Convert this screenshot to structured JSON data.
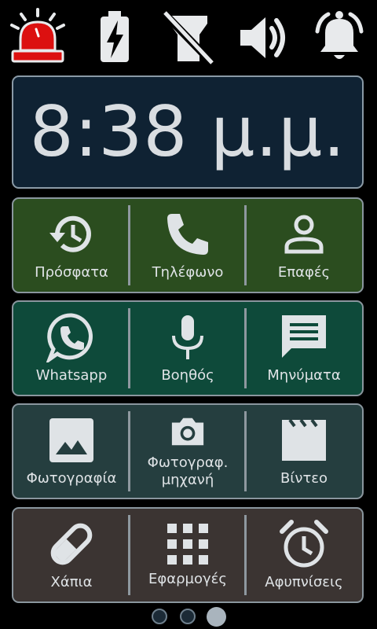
{
  "clock": {
    "time": "8:38 μ.μ."
  },
  "status_icons": [
    "alarm-siren-icon",
    "battery-charging-icon",
    "flashlight-off-icon",
    "volume-icon",
    "bell-icon"
  ],
  "rows": [
    {
      "color": "#2b4d1f",
      "items": [
        {
          "label": "Πρόσφατα",
          "icon": "history-icon"
        },
        {
          "label": "Τηλέφωνο",
          "icon": "phone-icon"
        },
        {
          "label": "Επαφές",
          "icon": "contact-icon"
        }
      ]
    },
    {
      "color": "#0e4a3a",
      "items": [
        {
          "label": "Whatsapp",
          "icon": "whatsapp-icon"
        },
        {
          "label": "Βοηθός",
          "icon": "microphone-icon"
        },
        {
          "label": "Μηνύματα",
          "icon": "message-icon"
        }
      ]
    },
    {
      "color": "#253e3f",
      "items": [
        {
          "label": "Φωτογραφία",
          "icon": "image-icon"
        },
        {
          "label": "Φωτογραφ.\nμηχανή",
          "icon": "camera-icon"
        },
        {
          "label": "Βίντεο",
          "icon": "clapperboard-icon"
        }
      ]
    },
    {
      "color": "#3b3432",
      "items": [
        {
          "label": "Χάπια",
          "icon": "pill-icon"
        },
        {
          "label": "Εφαρμογές",
          "icon": "apps-grid-icon"
        },
        {
          "label": "Αφυπνίσεις",
          "icon": "alarm-clock-icon"
        }
      ]
    }
  ],
  "pager": {
    "pages": 3,
    "current": 3
  }
}
